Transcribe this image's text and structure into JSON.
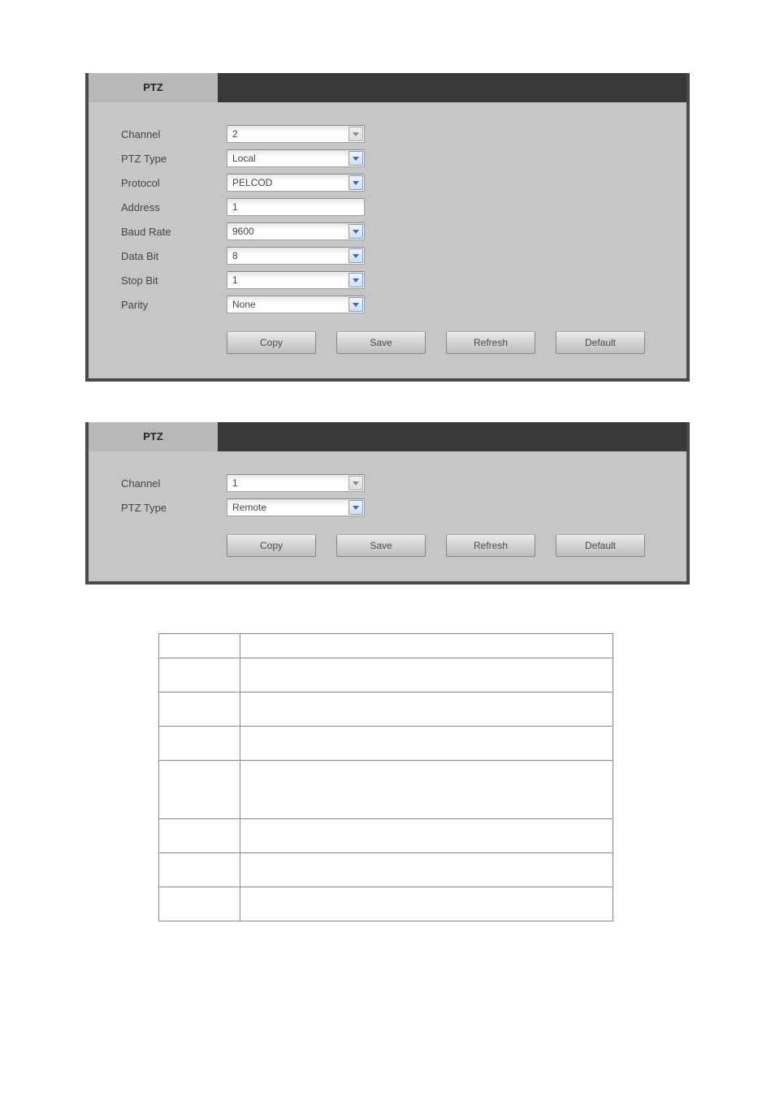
{
  "panel1": {
    "tab": "PTZ",
    "rows": {
      "channel_label": "Channel",
      "channel_value": "2",
      "ptztype_label": "PTZ Type",
      "ptztype_value": "Local",
      "protocol_label": "Protocol",
      "protocol_value": "PELCOD",
      "address_label": "Address",
      "address_value": "1",
      "baud_label": "Baud Rate",
      "baud_value": "9600",
      "databit_label": "Data Bit",
      "databit_value": "8",
      "stopbit_label": "Stop Bit",
      "stopbit_value": "1",
      "parity_label": "Parity",
      "parity_value": "None"
    },
    "buttons": {
      "copy": "Copy",
      "save": "Save",
      "refresh": "Refresh",
      "default": "Default"
    }
  },
  "panel2": {
    "tab": "PTZ",
    "rows": {
      "channel_label": "Channel",
      "channel_value": "1",
      "ptztype_label": "PTZ Type",
      "ptztype_value": "Remote"
    },
    "buttons": {
      "copy": "Copy",
      "save": "Save",
      "refresh": "Refresh",
      "default": "Default"
    }
  }
}
